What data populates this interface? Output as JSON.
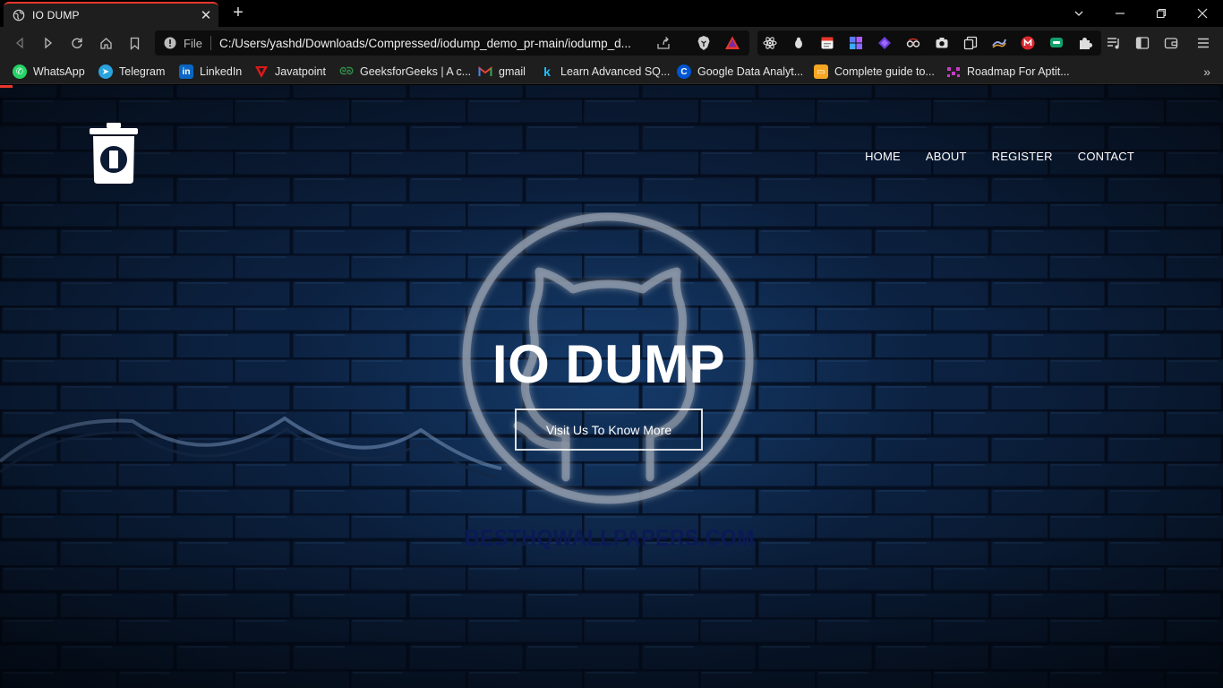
{
  "browser": {
    "tab": {
      "title": "IO DUMP",
      "icon": "globe-icon"
    },
    "url_scheme": "File",
    "url": "C:/Users/yashd/Downloads/Compressed/iodump_demo_pr-main/iodump_d...",
    "window_controls": [
      "chevron-down-icon",
      "minimize-icon",
      "restore-icon",
      "close-icon"
    ]
  },
  "bookmarks": [
    {
      "label": "WhatsApp",
      "icon": "whatsapp-icon"
    },
    {
      "label": "Telegram",
      "icon": "telegram-icon"
    },
    {
      "label": "LinkedIn",
      "icon": "linkedin-icon"
    },
    {
      "label": "Javatpoint",
      "icon": "javatpoint-icon"
    },
    {
      "label": "GeeksforGeeks | A c...",
      "icon": "geeksforgeeks-icon"
    },
    {
      "label": "gmail",
      "icon": "gmail-icon"
    },
    {
      "label": "Learn Advanced SQ...",
      "icon": "kaggle-icon"
    },
    {
      "label": "Google Data Analyt...",
      "icon": "coursera-icon"
    },
    {
      "label": "Complete guide to...",
      "icon": "article-icon"
    },
    {
      "label": "Roadmap For Aptit...",
      "icon": "roadmap-icon"
    }
  ],
  "site": {
    "nav": [
      "HOME",
      "ABOUT",
      "REGISTER",
      "CONTACT"
    ],
    "hero_title": "IO DUMP",
    "hero_button": "Visit Us To Know More",
    "watermark": "BESTHQWALLPAPERS.COM"
  },
  "colors": {
    "accent": "#e8372b",
    "page_background": "#0c2242",
    "text": "#ffffff"
  }
}
